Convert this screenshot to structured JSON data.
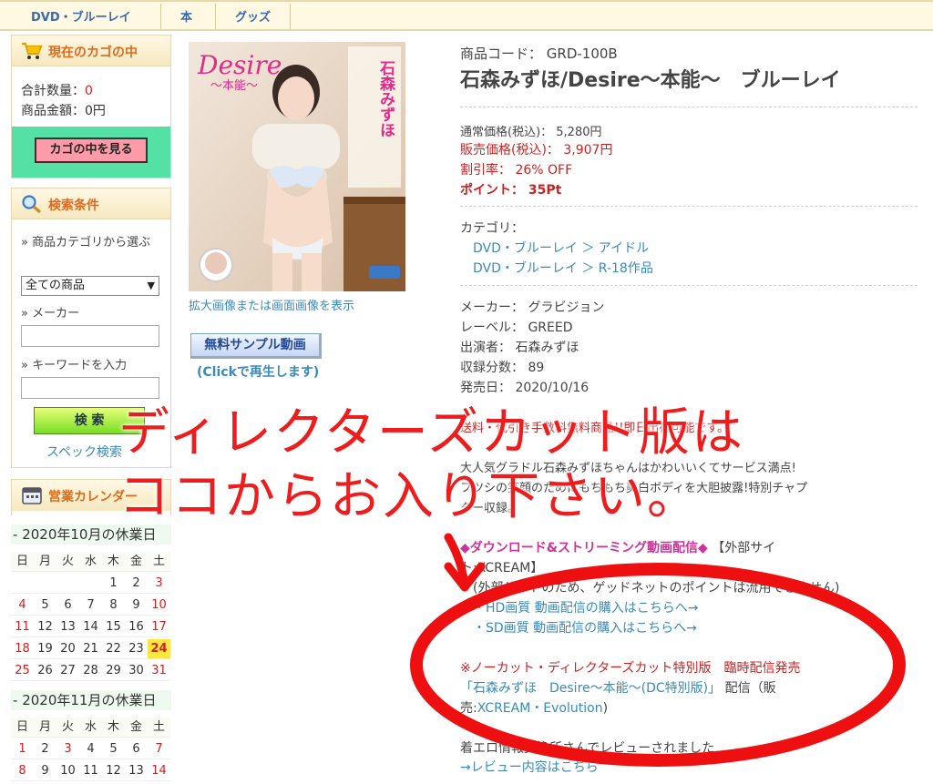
{
  "nav": {
    "tabs": [
      "DVD・ブルーレイ",
      "本",
      "グッズ"
    ]
  },
  "cart": {
    "title": "現在のカゴの中",
    "qty_label": "合計数量：",
    "qty_value": "0",
    "amount_label": "商品金額：0円",
    "button": "カゴの中を見る"
  },
  "search": {
    "title": "検索条件",
    "category_label": "商品カテゴリから選ぶ",
    "category_selected": "全ての商品",
    "maker_label": "メーカー",
    "keyword_label": "キーワードを入力",
    "button": "検 索",
    "spec_link": "スペック検索"
  },
  "calendar": {
    "title": "営業カレンダー",
    "months": [
      {
        "title": "2020年10月の休業日",
        "weekdays": [
          "日",
          "月",
          "火",
          "水",
          "木",
          "金",
          "土"
        ],
        "weeks": [
          [
            "",
            "",
            "",
            "",
            "1",
            "2",
            "3"
          ],
          [
            "4",
            "5",
            "6",
            "7",
            "8",
            "9",
            "10"
          ],
          [
            "11",
            "12",
            "13",
            "14",
            "15",
            "16",
            "17"
          ],
          [
            "18",
            "19",
            "20",
            "21",
            "22",
            "23",
            "24"
          ],
          [
            "25",
            "26",
            "27",
            "28",
            "29",
            "30",
            "31"
          ]
        ],
        "today": "24"
      },
      {
        "title": "2020年11月の休業日",
        "weekdays": [
          "日",
          "月",
          "火",
          "水",
          "木",
          "金",
          "土"
        ],
        "weeks": [
          [
            "1",
            "2",
            "3",
            "4",
            "5",
            "6",
            "7"
          ],
          [
            "8",
            "9",
            "10",
            "11",
            "12",
            "13",
            "14"
          ]
        ],
        "holiday": "3"
      }
    ]
  },
  "product": {
    "cover_title": "Desire",
    "cover_subtitle": "〜本能〜",
    "cover_name": "石森みずほ",
    "image_caption": "拡大画像または画面画像を表示",
    "sample_button": "無料サンプル動画",
    "sample_sub": "(Clickで再生します)",
    "code_label": "商品コード： GRD-100B",
    "title": "石森みずほ/Desire〜本能〜　ブルーレイ",
    "list_price": "通常価格(税込)： 5,280円",
    "sale_price": "販売価格(税込)： 3,907円",
    "discount": "割引率： 26% OFF",
    "points": "ポイント： 35Pt",
    "category_label": "カテゴリ：",
    "categories": [
      "DVD・ブルーレイ ＞ アイドル",
      "DVD・ブルーレイ ＞ R-18作品"
    ],
    "maker": "メーカー： グラビジョン",
    "label": "レーベル： GREED",
    "performer": "出演者： 石森みずほ",
    "duration": "収録分数： 89",
    "release": "発売日： 2020/10/16",
    "shipping_note": "送料・代引き手数料無料商品!!即日出荷可能です。",
    "desc_line1": "大人気グラドル石森みずほちゃんはかわいいくてサービス満点!",
    "desc_line2": "フツシの笑顔のためにもちもち美白ボディを大胆披露!特別チャプ",
    "desc_line3": "ター収録。",
    "dl_head": "◆ダウンロード&ストリーミング動画配信◆",
    "dl_head_tail": "【外部サイ",
    "dl_site": "ト:XCREAM】",
    "dl_note": "(外部サイトのため、ゲッドネットのポイントは流用できません)",
    "dl_hd": "・HD画質 動画配信の購入はこちらへ→",
    "dl_sd": "・SD画質 動画配信の購入はこちらへ→",
    "dc_title": "※ノーカット・ディレクターズカット特別版　臨時配信発売",
    "dc_line_link": "「石森みずほ　Desire〜本能〜(DC特別版)」",
    "dc_line_rest": "配信（販",
    "dc_line2_a": "売:",
    "dc_line2_link": "XCREAM・Evolution",
    "dc_line2_b": ")",
    "review_note": "着エロ情報交換所さんでレビューされました",
    "review_link": "→レビュー内容はこちら"
  },
  "overlay": {
    "line1": "ディレクターズカット版は",
    "line2": "ココからお入り下さい。"
  }
}
